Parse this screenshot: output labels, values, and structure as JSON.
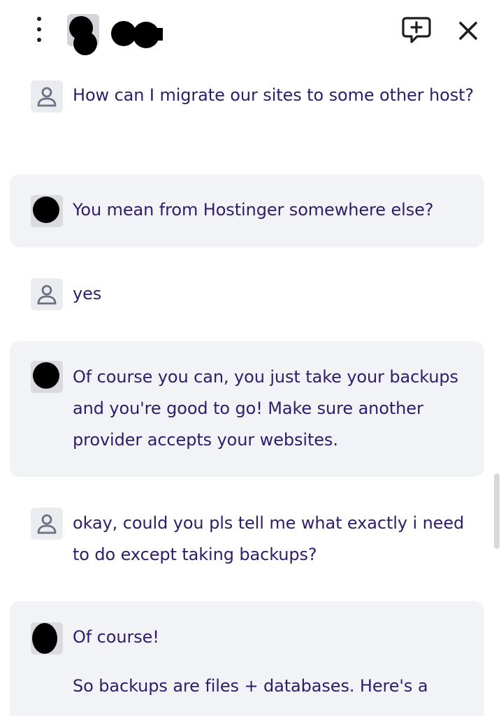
{
  "header": {
    "menu_icon": "more-vertical-icon",
    "agent_avatar": "agent-avatar-redacted",
    "agent_name_redacted": "agent-name-redacted",
    "new_chat_icon": "message-plus-icon",
    "close_icon": "close-icon"
  },
  "messages": [
    {
      "role": "user",
      "avatar_icon": "user-icon",
      "lines": [
        "How can I migrate our sites to some other host?"
      ]
    },
    {
      "role": "agent",
      "avatar_icon": "agent-avatar",
      "lines": [
        "You mean from Hostinger somewhere else?"
      ]
    },
    {
      "role": "user",
      "avatar_icon": "user-icon",
      "lines": [
        "yes"
      ]
    },
    {
      "role": "agent",
      "avatar_icon": "agent-avatar",
      "lines": [
        "Of course you can, you just take your backups and you're good to go! Make sure another provider accepts your websites."
      ]
    },
    {
      "role": "user",
      "avatar_icon": "user-icon",
      "lines": [
        "okay, could you pls tell me what exactly i need to do except taking backups?"
      ]
    },
    {
      "role": "agent",
      "avatar_icon": "agent-avatar",
      "lines": [
        "Of course!",
        "So backups are files + databases. Here's a"
      ]
    }
  ],
  "colors": {
    "text": "#2f1c6a",
    "agent_bubble": "#f2f3f6",
    "icon": "#1d1e20",
    "user_icon": "#6d7081"
  }
}
